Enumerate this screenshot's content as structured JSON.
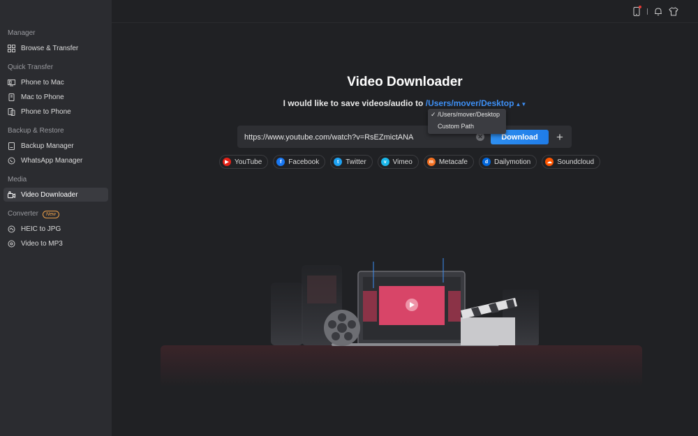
{
  "sidebar": {
    "sections": [
      {
        "title": "Manager",
        "items": [
          {
            "label": "Browse & Transfer",
            "icon": "grid-icon"
          }
        ]
      },
      {
        "title": "Quick Transfer",
        "items": [
          {
            "label": "Phone to Mac",
            "icon": "phone-to-mac-icon"
          },
          {
            "label": "Mac to Phone",
            "icon": "mac-to-phone-icon"
          },
          {
            "label": "Phone to Phone",
            "icon": "phone-to-phone-icon"
          }
        ]
      },
      {
        "title": "Backup & Restore",
        "items": [
          {
            "label": "Backup Manager",
            "icon": "backup-icon"
          },
          {
            "label": "WhatsApp Manager",
            "icon": "whatsapp-icon"
          }
        ]
      },
      {
        "title": "Media",
        "items": [
          {
            "label": "Video Downloader",
            "icon": "video-downloader-icon",
            "active": true
          }
        ]
      },
      {
        "title": "Converter",
        "badge": "New",
        "items": [
          {
            "label": "HEIC to JPG",
            "icon": "heic-icon"
          },
          {
            "label": "Video to MP3",
            "icon": "mp3-icon"
          }
        ]
      }
    ]
  },
  "topbar": {
    "icons": [
      "device-icon",
      "bell-icon",
      "shirt-icon"
    ]
  },
  "main": {
    "title": "Video Downloader",
    "save_prefix": "I would like to save videos/audio to",
    "save_path": "/Users/mover/Desktop",
    "dropdown": {
      "options": [
        "/Users/mover/Desktop",
        "Custom Path"
      ],
      "selected": 0
    },
    "url_value": "https://www.youtube.com/watch?v=RsEZmictANA",
    "download_label": "Download",
    "plus_label": "+",
    "sites": [
      {
        "label": "YouTube",
        "color": "#e62117"
      },
      {
        "label": "Facebook",
        "color": "#1877f2"
      },
      {
        "label": "Twitter",
        "color": "#1da1f2"
      },
      {
        "label": "Vimeo",
        "color": "#1ab7ea"
      },
      {
        "label": "Metacafe",
        "color": "#f37021"
      },
      {
        "label": "Dailymotion",
        "color": "#0066dc"
      },
      {
        "label": "Soundcloud",
        "color": "#ff5500"
      }
    ]
  },
  "colors": {
    "accent": "#2e8ff0",
    "sidebar_bg": "#2b2c30",
    "main_bg": "#202124"
  }
}
